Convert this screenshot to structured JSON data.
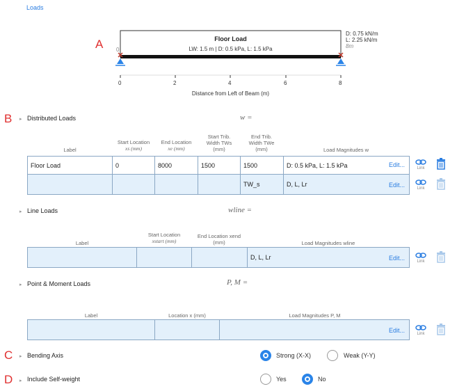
{
  "header": {
    "loads_link": "Loads"
  },
  "markers": {
    "a": "A",
    "b": "B",
    "c": "C",
    "d": "D"
  },
  "diagram": {
    "title": "Floor Load",
    "subtitle": "LW: 1.5 m | D: 0.5 kPa, L: 1.5 kPa",
    "right_label_d": "D: 0.75 kN/m",
    "right_label_l": "L: 2.25 kN/m",
    "left_value": "0",
    "right_value": "8m",
    "ticks": [
      "0",
      "2",
      "4",
      "6",
      "8"
    ],
    "axis_label": "Distance from Left of Beam (m)"
  },
  "distributed": {
    "title": "Distributed Loads",
    "symbol": "w =",
    "headers": {
      "label": "Label",
      "start_loc": "Start Location",
      "start_loc_sub": "xs (mm)",
      "end_loc": "End Location",
      "end_loc_sub": "xe (mm)",
      "start_trib": "Start Trib.",
      "start_trib2": "Width TWs",
      "start_trib_unit": "(mm)",
      "end_trib": "End Trib.",
      "end_trib2": "Width TWe",
      "end_trib_unit": "(mm)",
      "magnitudes": "Load Magnitudes w"
    },
    "rows": [
      {
        "label": "Floor Load",
        "start": "0",
        "end": "8000",
        "start_trib": "1500",
        "end_trib": "1500",
        "mags": "D: 0.5 kPa, L: 1.5 kPa",
        "edit": "Edit..."
      },
      {
        "label": "",
        "start": "",
        "end": "",
        "start_trib": "",
        "end_trib": "TW_s",
        "mags": "D, L, Lr",
        "edit": "Edit..."
      }
    ]
  },
  "line": {
    "title": "Line Loads",
    "symbol": "wline =",
    "headers": {
      "label": "Label",
      "start_loc": "Start Location",
      "start_loc_sub": "xstart (mm)",
      "end_loc": "End Location xend",
      "end_loc_unit": "(mm)",
      "magnitudes": "Load Magnitudes wline"
    },
    "row": {
      "mags": "D, L, Lr",
      "edit": "Edit..."
    }
  },
  "point": {
    "title": "Point & Moment Loads",
    "symbol": "P, M =",
    "headers": {
      "label": "Label",
      "location": "Location x (mm)",
      "magnitudes": "Load Magnitudes P, M"
    },
    "row": {
      "edit": "Edit..."
    }
  },
  "link_label": "Link",
  "bending": {
    "title": "Bending Axis",
    "opt1": "Strong (X-X)",
    "opt2": "Weak (Y-Y)",
    "selected": "Strong (X-X)"
  },
  "selfweight": {
    "title": "Include Self-weight",
    "opt1": "Yes",
    "opt2": "No",
    "selected": "No"
  }
}
